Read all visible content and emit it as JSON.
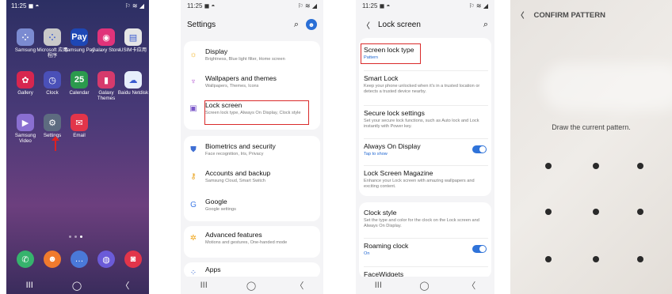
{
  "home": {
    "time": "11:25",
    "status_icons": "◼ ◓",
    "signal": "⚐ ≋ ◢",
    "apps_row1": [
      {
        "label": "Samsung",
        "color": "#7b8bd1",
        "glyph": "⁘"
      },
      {
        "label": "Microsoft 应用程序",
        "color": "#c9c9c9",
        "glyph": "⁘"
      },
      {
        "label": "Samsung Pay",
        "color": "#1e47b5",
        "glyph": "Pay"
      },
      {
        "label": "Galaxy Store",
        "color": "#e0337a",
        "glyph": "◉"
      },
      {
        "label": "USIM卡应用",
        "color": "#e6e6e6",
        "glyph": "▤"
      }
    ],
    "apps_row2": [
      {
        "label": "Gallery",
        "color": "#d7264f",
        "glyph": "✿"
      },
      {
        "label": "Clock",
        "color": "#4a50b8",
        "glyph": "◷"
      },
      {
        "label": "Calendar",
        "color": "#2b9a4d",
        "glyph": "25"
      },
      {
        "label": "Galaxy Themes",
        "color": "#d63a6c",
        "glyph": "▮"
      },
      {
        "label": "Baidu Netdisk",
        "color": "#e7eefc",
        "glyph": "☁"
      }
    ],
    "apps_row3": [
      {
        "label": "Samsung Video",
        "color": "#8a6fd1",
        "glyph": "▶"
      },
      {
        "label": "Settings",
        "color": "#5d6b80",
        "glyph": "⚙"
      },
      {
        "label": "Email",
        "color": "#e2354a",
        "glyph": "✉"
      }
    ],
    "dock": [
      {
        "name": "phone",
        "color": "#36b36d",
        "glyph": "✆"
      },
      {
        "name": "contacts",
        "color": "#f07a2d",
        "glyph": "☻"
      },
      {
        "name": "messages",
        "color": "#4a79d9",
        "glyph": "…"
      },
      {
        "name": "internet",
        "color": "#6b5bd8",
        "glyph": "◍"
      },
      {
        "name": "camera",
        "color": "#e2354a",
        "glyph": "◙"
      }
    ],
    "nav": {
      "recent": "III",
      "home": "◯",
      "back": "〈"
    }
  },
  "settings": {
    "time": "11:25",
    "status_icons": "◼ ◓",
    "signal": "⚐ ≋ ◢",
    "title": "Settings",
    "search_glyph": "⌕",
    "avatar_glyph": "☻",
    "items": [
      {
        "title": "Display",
        "sub": "Brightness, Blue light filter, Home screen",
        "glyph": "☼",
        "color": "#f2b01e"
      },
      {
        "title": "Wallpapers and themes",
        "sub": "Wallpapers, Themes, Icons",
        "glyph": "♆",
        "color": "#b45ad4"
      },
      {
        "title": "Lock screen",
        "sub": "Screen lock type, Always On Display, Clock style",
        "glyph": "▣",
        "color": "#7b58c9"
      },
      {
        "title": "Biometrics and security",
        "sub": "Face recognition, Iris, Privacy",
        "glyph": "⛊",
        "color": "#3f6fd3"
      },
      {
        "title": "Accounts and backup",
        "sub": "Samsung Cloud, Smart Switch",
        "glyph": "⚷",
        "color": "#e9a11a"
      },
      {
        "title": "Google",
        "sub": "Google settings",
        "glyph": "G",
        "color": "#3f7be6"
      },
      {
        "title": "Advanced features",
        "sub": "Motions and gestures, One-handed mode",
        "glyph": "✲",
        "color": "#f0a61b"
      },
      {
        "title": "Apps",
        "sub": "",
        "glyph": "⁘",
        "color": "#3f6fd3"
      }
    ],
    "nav": {
      "recent": "III",
      "home": "◯",
      "back": "〈"
    }
  },
  "lockscreen": {
    "time": "11:25",
    "status_icons": "◼ ◓",
    "signal": "⚐ ≋ ◢",
    "back_glyph": "〈",
    "title": "Lock screen",
    "search_glyph": "⌕",
    "items": [
      {
        "title": "Screen lock type",
        "sub": "Pattern",
        "sub_blue": true
      },
      {
        "title": "Smart Lock",
        "sub": "Keep your phone unlocked when it's in a trusted location or detects a trusted device nearby.",
        "sub_blue": false
      },
      {
        "title": "Secure lock settings",
        "sub": "Set your secure lock functions, such as Auto lock and Lock instantly with Power key.",
        "sub_blue": false
      },
      {
        "title": "Always On Display",
        "sub": "Tap to show",
        "sub_blue": true,
        "toggle": true
      },
      {
        "title": "Lock Screen Magazine",
        "sub": "Enhance your Lock screen with amazing wallpapers and exciting content.",
        "sub_blue": false
      },
      {
        "title": "Clock style",
        "sub": "Set the type and color for the clock on the Lock screen and Always On Display.",
        "sub_blue": false
      },
      {
        "title": "Roaming clock",
        "sub": "On",
        "sub_blue": true,
        "toggle": true
      },
      {
        "title": "FaceWidgets",
        "sub": "",
        "sub_blue": false
      }
    ],
    "nav": {
      "recent": "III",
      "home": "◯",
      "back": "〈"
    }
  },
  "pattern": {
    "back_glyph": "〈",
    "title": "CONFIRM PATTERN",
    "message": "Draw the current pattern."
  },
  "colors": {
    "highlight": "#d92a2a",
    "accent": "#2f73d9"
  }
}
